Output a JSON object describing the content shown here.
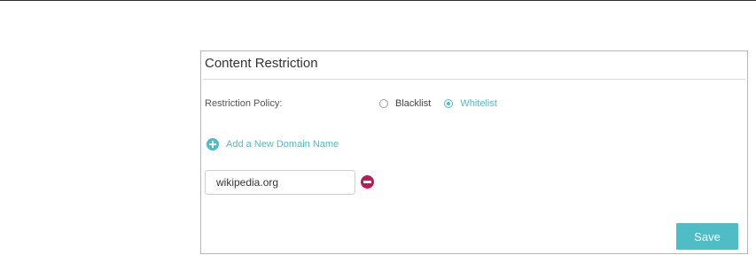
{
  "panel": {
    "title": "Content Restriction"
  },
  "restriction_policy": {
    "label": "Restriction Policy:",
    "options": [
      {
        "label": "Blacklist",
        "selected": false
      },
      {
        "label": "Whitelist",
        "selected": true
      }
    ]
  },
  "add_domain": {
    "label": "Add a New Domain Name",
    "icon": "plus-circle-icon"
  },
  "domains": [
    {
      "value": "wikipedia.org",
      "remove_icon": "minus-circle-icon"
    }
  ],
  "actions": {
    "save_label": "Save"
  },
  "colors": {
    "accent": "#4fbcc6",
    "remove": "#c4145a"
  }
}
